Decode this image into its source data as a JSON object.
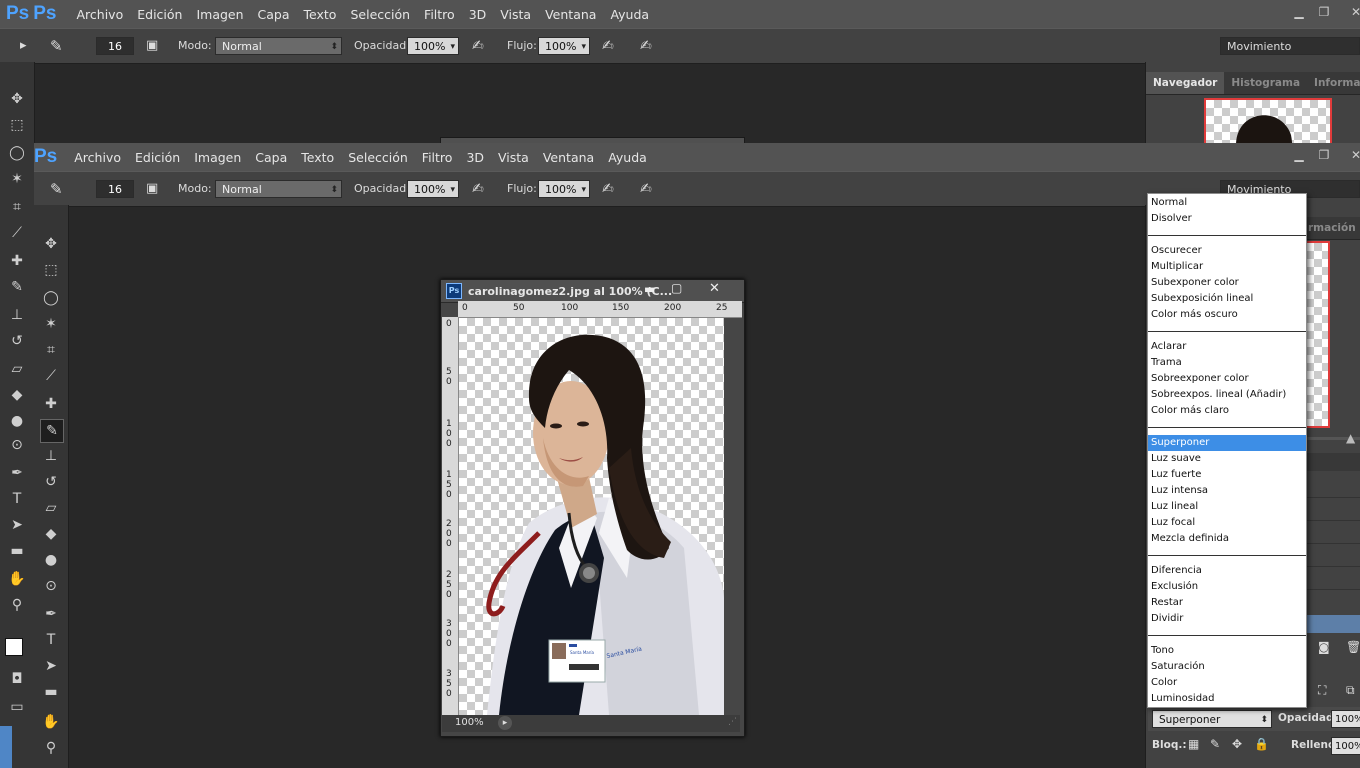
{
  "app": {
    "logo": "Ps"
  },
  "menu": [
    "Archivo",
    "Edición",
    "Imagen",
    "Capa",
    "Texto",
    "Selección",
    "Filtro",
    "3D",
    "Vista",
    "Ventana",
    "Ayuda"
  ],
  "options": {
    "brush_size": "16",
    "mode_label": "Modo:",
    "mode_value": "Normal",
    "opacity_label": "Opacidad:",
    "opacity_value": "100%",
    "flow_label": "Flujo:",
    "flow_value": "100%",
    "workspace": "Movimiento"
  },
  "right_panel": {
    "tabs": [
      "Navegador",
      "Histograma",
      "Información"
    ],
    "tab_fragment": "rmación"
  },
  "document": {
    "title": "carolinagomez2.jpg al 100% (C...",
    "zoom": "100%",
    "ruler_h": [
      "0",
      "50",
      "100",
      "150",
      "200",
      "25"
    ],
    "ruler_v": [
      "0",
      "5\n0",
      "1\n0\n0",
      "1\n5\n0",
      "2\n0\n0",
      "2\n5\n0",
      "3\n0\n0",
      "3\n5\n0"
    ]
  },
  "blend_modes": {
    "groups": [
      [
        "Normal",
        "Disolver"
      ],
      [
        "Oscurecer",
        "Multiplicar",
        "Subexponer color",
        "Subexposición lineal",
        "Color más oscuro"
      ],
      [
        "Aclarar",
        "Trama",
        "Sobreexponer color",
        "Sobreexpos. lineal (Añadir)",
        "Color más claro"
      ],
      [
        "Superponer",
        "Luz suave",
        "Luz fuerte",
        "Luz intensa",
        "Luz lineal",
        "Luz focal",
        "Mezcla definida"
      ],
      [
        "Diferencia",
        "Exclusión",
        "Restar",
        "Dividir"
      ],
      [
        "Tono",
        "Saturación",
        "Color",
        "Luminosidad"
      ]
    ],
    "selected": "Superponer"
  },
  "layers": {
    "blend_value": "Superponer",
    "opacity_label": "Opacidad:",
    "opacity_value": "100%",
    "lock_label": "Bloq.:",
    "fill_label": "Relleno:",
    "fill_value": "100%"
  },
  "id_card": {
    "line1": "Santa María",
    "line2": "Santa María"
  },
  "colors": {
    "accent": "#3d8ee6",
    "ps_blue": "#4ea3ff"
  }
}
